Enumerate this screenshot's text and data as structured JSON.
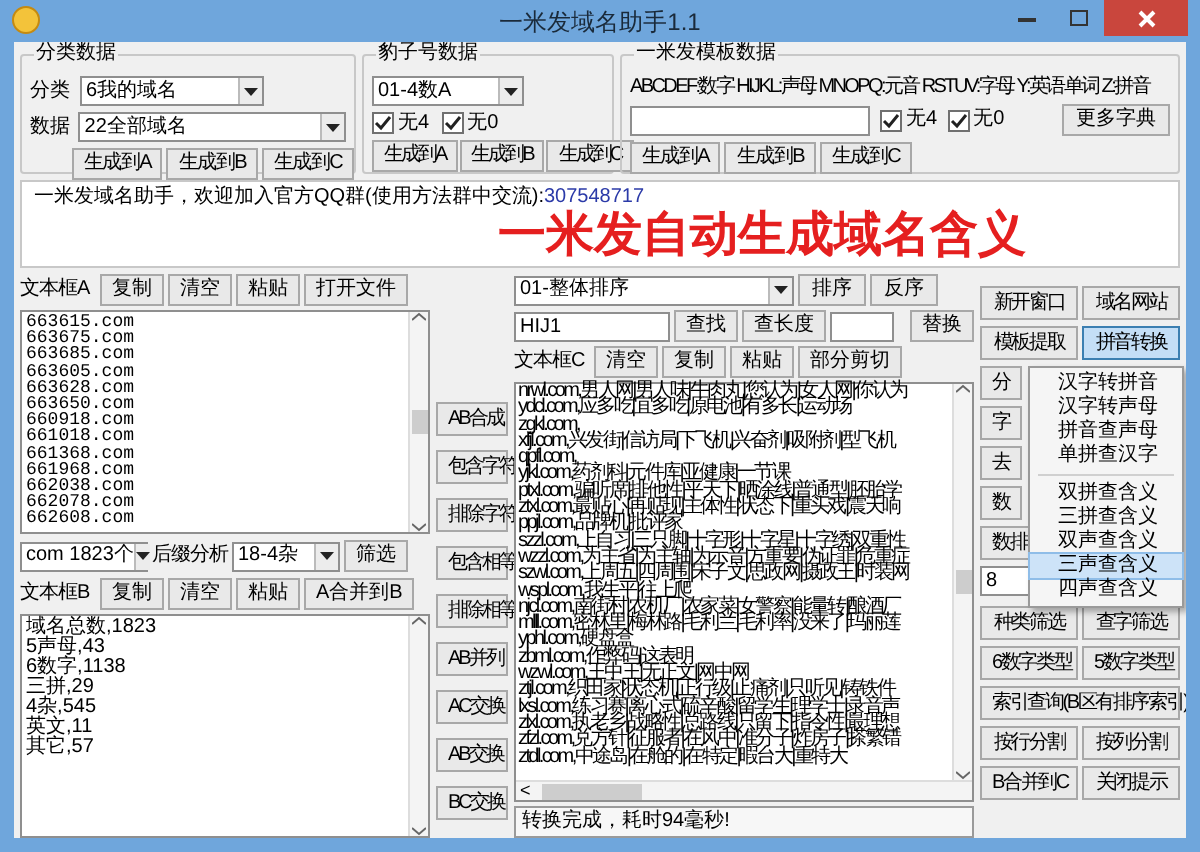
{
  "window": {
    "title": "一米发域名助手1.1"
  },
  "category_group": {
    "title": "分类数据",
    "fields": [
      {
        "label": "分类",
        "value": "6我的域名"
      },
      {
        "label": "数据",
        "value": "22全部域名"
      }
    ],
    "buttons": [
      "生成到A",
      "生成到B",
      "生成到C"
    ]
  },
  "leopard_group": {
    "title": "豹子号数据",
    "select": "01-4数A",
    "checkboxes": [
      {
        "label": "无4",
        "checked": true
      },
      {
        "label": "无0",
        "checked": true
      }
    ],
    "buttons": [
      "生成到A",
      "生成到B",
      "生成到C"
    ]
  },
  "template_group": {
    "title": "一米发模板数据",
    "legend": "ABCDEF:数字 HIJKL:声母 MNOPQ:元音 RSTUV:字母 Y:英语单词 Z:拼音",
    "checkboxes": [
      {
        "label": "无4",
        "checked": true
      },
      {
        "label": "无0",
        "checked": true
      }
    ],
    "dict_button": "更多字典",
    "buttons": [
      "生成到A",
      "生成到B",
      "生成到C"
    ]
  },
  "notice": {
    "text": "一米发域名助手，欢迎加入官方QQ群(使用方法群中交流):",
    "qq": "307548717",
    "headline": "一米发自动生成域名含义"
  },
  "text_box_a": {
    "label": "文本框A",
    "buttons": [
      "复制",
      "清空",
      "粘贴",
      "打开文件"
    ],
    "lines": [
      "663615.com",
      "663675.com",
      "663685.com",
      "663605.com",
      "663628.com",
      "663650.com",
      "660918.com",
      "661018.com",
      "661368.com",
      "661968.com",
      "662038.com",
      "662078.com",
      "662608.com"
    ]
  },
  "suffix_row": {
    "suffix_select": "com 1823个",
    "label": "后缀分析",
    "type_select": "18-4杂",
    "filter_button": "筛选"
  },
  "text_box_b": {
    "label": "文本框B",
    "buttons": [
      "复制",
      "清空",
      "粘贴",
      "A合并到B"
    ],
    "lines": [
      "域名总数,1823",
      "5声母,43",
      "6数字,1138",
      "三拼,29",
      "4杂,545",
      "英文,11",
      "其它,57"
    ]
  },
  "middle_buttons": [
    "AB合成",
    "包含字符",
    "排除字符",
    "包含相等",
    "排除相等",
    "AB并列",
    "AC交换",
    "AB交换",
    "BC交换"
  ],
  "sort_row": {
    "select": "01-整体排序",
    "buttons": [
      "排序",
      "反序"
    ]
  },
  "find_row": {
    "query": "HIJ1",
    "buttons": [
      "查找",
      "查长度"
    ],
    "replace_button": "替换"
  },
  "text_box_c": {
    "label": "文本框C",
    "buttons": [
      "清空",
      "复制",
      "粘贴",
      "部分剪切"
    ],
    "lines": [
      "nrwl.com,男人网|男人味|牛肉丸|您认为|女人网|你认为",
      "ydcl.com,应多吃|宜多吃|原电池|有多长|运动场",
      "zgkl.com,",
      "xfjl.com,兴发街|信访局|下飞机|兴奋剂|吸附剂|型飞机",
      "qpfl.com,",
      "yjkl.com,药剂科|元件库|亚健康|一节课",
      "ptxl.com,骗听席|排他性|平天下|晒涂线|普通型|胚胎学",
      "ztxl.com,最贴心|再贴现|主体性|状态下|重头戏|震天响",
      "ppjl.com,品牌机|批评家",
      "szzl.com,上自习|三只脚|十字形|十字星|十字绣|双重性",
      "wzzl.com,为主省|为主轴|为示音|方重要|伪证罪|危重症",
      "szwl.com,上周五|四周围|宋子文|思政网|摄政王|时装网",
      "wspl.com,我生平|往上爬",
      "njcl.com,南街村|农机厂|农家菜|女警察|能量转|酿酒厂",
      "mlll.com,密林里|梅林路|毛利兰|毛利率|没来了|玛丽莲",
      "yphl.com,硬盘盒",
      "zbml.com,作弊码|这表明",
      "wzwl.com,王中王|无正文|网中网",
      "ztjl.com,织田家|状态机|正行级|止痛剂|只听见|铸铁件",
      "lxsl.com,练习赛|离心式|硫辛酸|留学生|理学士|录音声",
      "zlxl.com,执老乡|战略性|总路线|只留下|指令性|最理想",
      "zfzl.com,兑方针|征服者|在风中|准分子|炸房子|搽繁错",
      "ztdl.com,中途岛|在舱的|在特定|暇台大|重特大"
    ],
    "scroll_left": "<"
  },
  "status": "转换完成，耗时94毫秒!",
  "right_panel": [
    {
      "kind": "pair",
      "buttons": [
        {
          "label": "新开窗口",
          "pressed": false
        },
        {
          "label": "域名网站",
          "pressed": false
        }
      ]
    },
    {
      "kind": "pair",
      "buttons": [
        {
          "label": "模板提取",
          "pressed": false
        },
        {
          "label": "拼音转换",
          "pressed": true
        }
      ]
    },
    {
      "kind": "partial",
      "buttons": [
        {
          "label": "分",
          "pressed": false
        }
      ]
    },
    {
      "kind": "partial",
      "buttons": [
        {
          "label": "字",
          "pressed": false
        }
      ]
    },
    {
      "kind": "partial",
      "buttons": [
        {
          "label": "去",
          "pressed": false
        }
      ]
    },
    {
      "kind": "partial",
      "buttons": [
        {
          "label": "数",
          "pressed": false
        }
      ]
    },
    {
      "kind": "partial",
      "buttons": [
        {
          "label": "数排",
          "pressed": false
        }
      ]
    },
    {
      "kind": "input",
      "value": "8"
    },
    {
      "kind": "pair",
      "buttons": [
        {
          "label": "种类筛选",
          "pressed": false
        },
        {
          "label": "查字筛选",
          "pressed": false
        }
      ]
    },
    {
      "kind": "pair",
      "buttons": [
        {
          "label": "6数字类型",
          "pressed": false
        },
        {
          "label": "5数字类型",
          "pressed": false
        }
      ]
    },
    {
      "kind": "single",
      "buttons": [
        {
          "label": "索引查询(B区有排序索引)",
          "pressed": false
        }
      ]
    },
    {
      "kind": "pair",
      "buttons": [
        {
          "label": "按行分割",
          "pressed": false
        },
        {
          "label": "按列分割",
          "pressed": false
        }
      ]
    },
    {
      "kind": "pair",
      "buttons": [
        {
          "label": "B合并到C",
          "pressed": false
        },
        {
          "label": "关闭提示",
          "pressed": false
        }
      ]
    }
  ],
  "menu": {
    "groups": [
      [
        {
          "label": "汉字转拼音",
          "selected": false
        },
        {
          "label": "汉字转声母",
          "selected": false
        },
        {
          "label": "拼音查声母",
          "selected": false
        },
        {
          "label": "单拼查汉字",
          "selected": false
        }
      ],
      [
        {
          "label": "双拼查含义",
          "selected": false
        },
        {
          "label": "三拼查含义",
          "selected": false
        },
        {
          "label": "双声查含义",
          "selected": false
        },
        {
          "label": "三声查含义",
          "selected": true
        },
        {
          "label": "四声查含义",
          "selected": false
        }
      ]
    ]
  }
}
